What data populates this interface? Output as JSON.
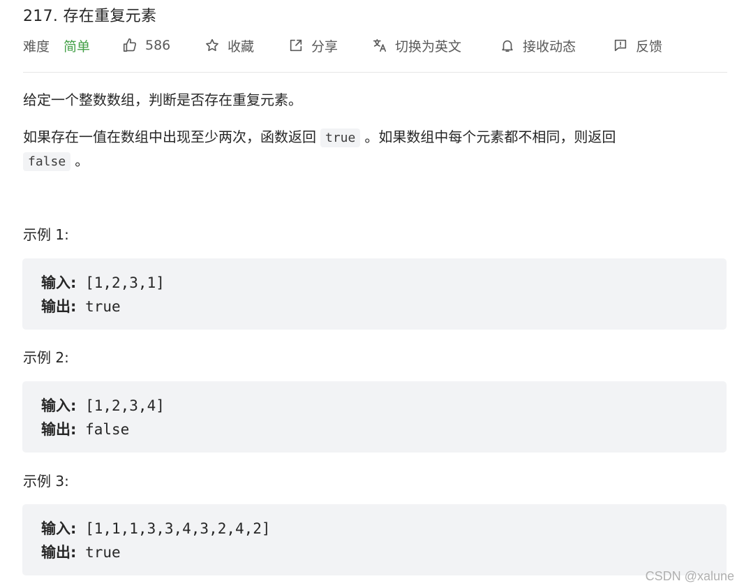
{
  "problem": {
    "title": "217. 存在重复元素",
    "difficulty_label": "难度",
    "difficulty_value": "简单",
    "likes": "586",
    "favorite_label": "收藏",
    "share_label": "分享",
    "switch_lang_label": "切换为英文",
    "subscribe_label": "接收动态",
    "feedback_label": "反馈",
    "accent_color": "#43a047"
  },
  "description": {
    "p1": "给定一个整数数组，判断是否存在重复元素。",
    "p2_before": "如果存在一值在数组中出现至少两次，函数返回",
    "p2_code1": "true",
    "p2_middle": "。如果数组中每个元素都不相同，则返回",
    "p2_code2": "false",
    "p2_end": "。"
  },
  "examples": [
    {
      "title": "示例 1:",
      "input_label": "输入:",
      "input": "[1,2,3,1]",
      "output_label": "输出:",
      "output": "true"
    },
    {
      "title": "示例 2:",
      "input_label": "输入:",
      "input": "[1,2,3,4]",
      "output_label": "输出:",
      "output": "false"
    },
    {
      "title": "示例 3:",
      "input_label": "输入:",
      "input": "[1,1,1,3,3,4,3,2,4,2]",
      "output_label": "输出:",
      "output": "true"
    }
  ],
  "watermark": "CSDN @xalune"
}
